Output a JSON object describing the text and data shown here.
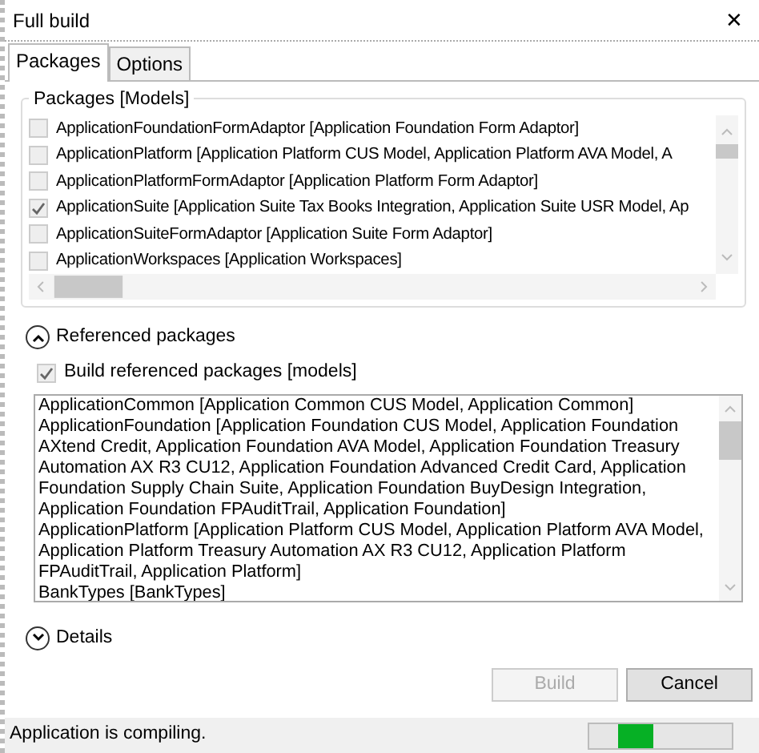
{
  "window": {
    "title": "Full build",
    "close": "✕"
  },
  "tabs": [
    {
      "label": "Packages",
      "selected": true
    },
    {
      "label": "Options",
      "selected": false
    }
  ],
  "packages": {
    "legend": "Packages [Models]",
    "items": [
      {
        "label": "ApplicationFoundationFormAdaptor [Application Foundation Form Adaptor]",
        "checked": false
      },
      {
        "label": "ApplicationPlatform [Application Platform CUS Model, Application Platform AVA Model, A",
        "checked": false
      },
      {
        "label": "ApplicationPlatformFormAdaptor [Application Platform Form Adaptor]",
        "checked": false
      },
      {
        "label": "ApplicationSuite [Application Suite Tax Books Integration, Application Suite USR Model, Ap",
        "checked": true
      },
      {
        "label": "ApplicationSuiteFormAdaptor [Application Suite Form Adaptor]",
        "checked": false
      },
      {
        "label": "ApplicationWorkspaces [Application Workspaces]",
        "checked": false
      }
    ]
  },
  "referenced": {
    "label": "Referenced packages",
    "expanded": true,
    "build_option": {
      "label": "Build referenced packages [models]",
      "checked": true
    },
    "items": [
      "ApplicationCommon [Application Common CUS Model, Application Common]",
      "ApplicationFoundation [Application Foundation CUS Model, Application Foundation AXtend Credit, Application Foundation AVA Model, Application Foundation Treasury Automation AX R3 CU12, Application Foundation Advanced Credit Card, Application Foundation Supply Chain Suite, Application Foundation BuyDesign Integration, Application Foundation FPAuditTrail, Application Foundation]",
      "ApplicationPlatform [Application Platform CUS Model, Application Platform AVA Model, Application Platform Treasury Automation AX R3 CU12, Application Platform FPAuditTrail, Application Platform]",
      "BankTypes [BankTypes]"
    ]
  },
  "details": {
    "label": "Details",
    "expanded": false
  },
  "buttons": [
    {
      "label": "Build",
      "disabled": true
    },
    {
      "label": "Cancel",
      "disabled": false
    }
  ],
  "status_bar": {
    "text": "Application is compiling.",
    "progress": {
      "level": 0.24
    }
  }
}
